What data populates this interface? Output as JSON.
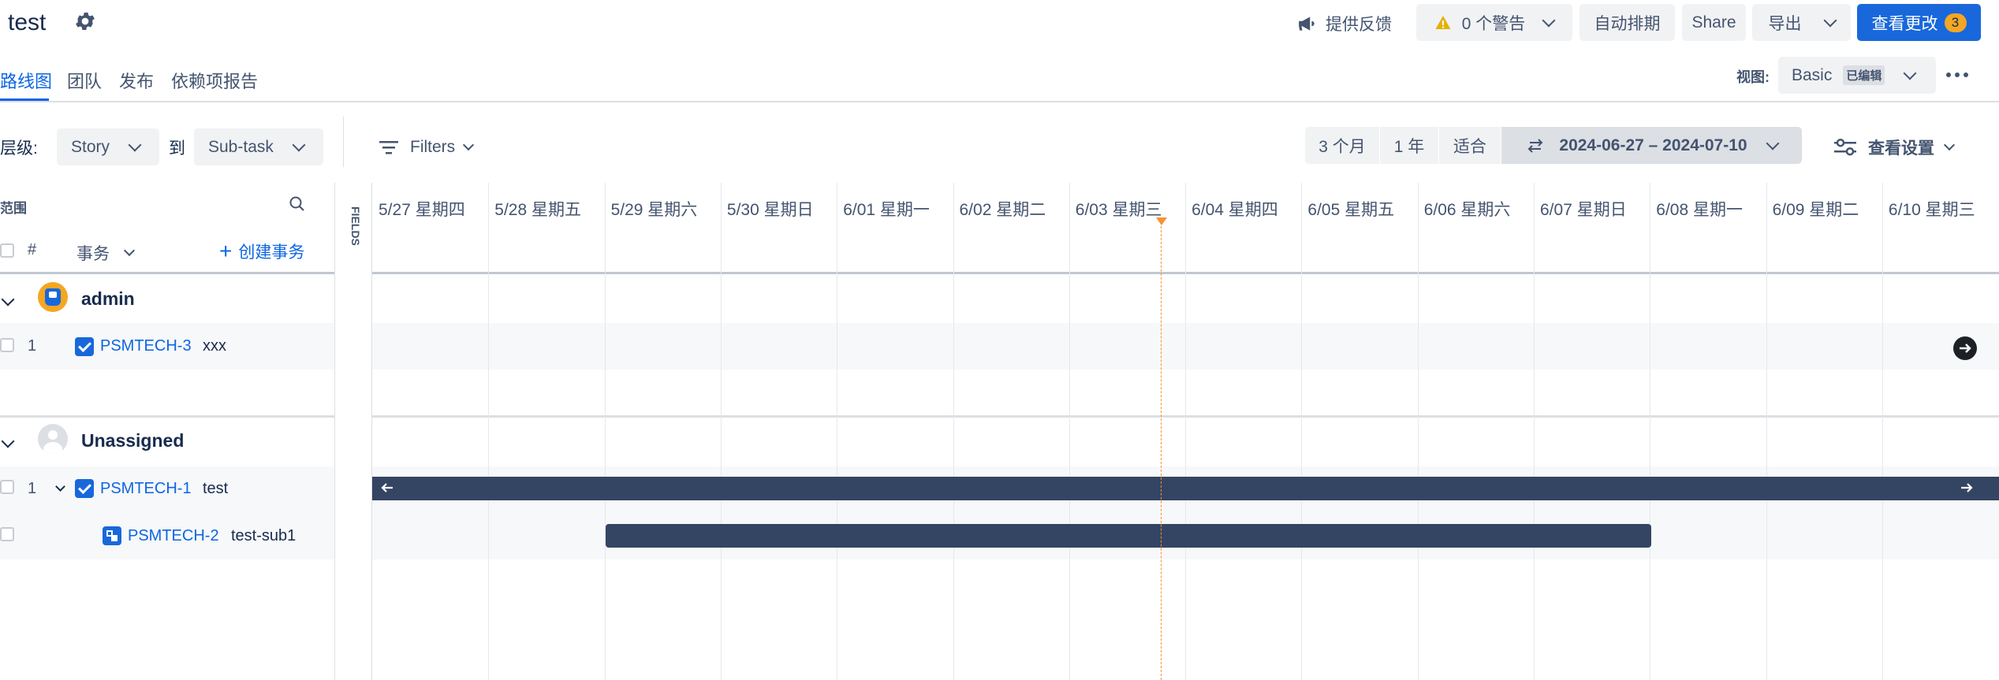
{
  "header": {
    "title": "test",
    "feedback_label": "提供反馈",
    "warnings_label": "0 个警告",
    "auto_schedule_label": "自动排期",
    "share_label": "Share",
    "export_label": "导出",
    "review_changes_label": "查看更改",
    "review_changes_count": "3"
  },
  "tabs": [
    {
      "label": "路线图",
      "active": true
    },
    {
      "label": "团队"
    },
    {
      "label": "发布"
    },
    {
      "label": "依赖项报告"
    }
  ],
  "view": {
    "label": "视图:",
    "value": "Basic",
    "badge": "已编辑"
  },
  "toolbar": {
    "level_label": "层级:",
    "level_from": "Story",
    "to_label": "到",
    "level_to": "Sub-task",
    "filters_label": "Filters",
    "range_3m": "3 个月",
    "range_1y": "1 年",
    "range_fit": "适合",
    "date_range": "2024-06-27 – 2024-07-10",
    "view_settings_label": "查看设置"
  },
  "scope": {
    "title": "范围",
    "col_hash": "#",
    "col_issue": "事务",
    "create_label": "创建事务",
    "fields_label": "FIELDS"
  },
  "timeline_dates": [
    "5/27 星期四",
    "5/28 星期五",
    "5/29 星期六",
    "5/30 星期日",
    "6/01 星期一",
    "6/02 星期二",
    "6/03 星期三",
    "6/04 星期四",
    "6/05 星期五",
    "6/06 星期六",
    "6/07 星期日",
    "6/08 星期一",
    "6/09 星期二",
    "6/10 星期三"
  ],
  "groups": [
    {
      "name": "admin",
      "rows": [
        {
          "num": "1",
          "key": "PSMTECH-3",
          "summary": "xxx"
        }
      ]
    },
    {
      "name": "Unassigned",
      "rows": [
        {
          "num": "1",
          "key": "PSMTECH-1",
          "summary": "test"
        },
        {
          "num": "",
          "key": "PSMTECH-2",
          "summary": "test-sub1"
        }
      ]
    }
  ],
  "colors": {
    "accent": "#1868db",
    "bar": "#344563",
    "today": "#f79232",
    "warning": "#e2b203"
  }
}
